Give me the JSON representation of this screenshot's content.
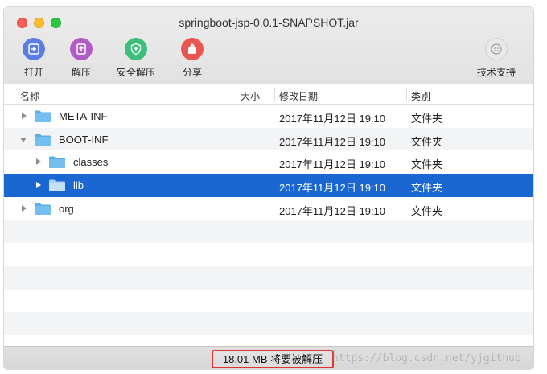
{
  "window": {
    "title": "springboot-jsp-0.0.1-SNAPSHOT.jar"
  },
  "toolbar": {
    "open_label": "打开",
    "extract_label": "解压",
    "secure_extract_label": "安全解压",
    "share_label": "分享",
    "support_label": "技术支持"
  },
  "columns": {
    "name": "名称",
    "size": "大小",
    "date": "修改日期",
    "kind": "类别"
  },
  "files": [
    {
      "name": "META-INF",
      "date": "2017年11月12日 19:10",
      "kind": "文件夹",
      "level": 0,
      "expanded": false,
      "selected": false
    },
    {
      "name": "BOOT-INF",
      "date": "2017年11月12日 19:10",
      "kind": "文件夹",
      "level": 0,
      "expanded": true,
      "selected": false
    },
    {
      "name": "classes",
      "date": "2017年11月12日 19:10",
      "kind": "文件夹",
      "level": 1,
      "expanded": false,
      "selected": false
    },
    {
      "name": "lib",
      "date": "2017年11月12日 19:10",
      "kind": "文件夹",
      "level": 1,
      "expanded": false,
      "selected": true
    },
    {
      "name": "org",
      "date": "2017年11月12日 19:10",
      "kind": "文件夹",
      "level": 0,
      "expanded": false,
      "selected": false
    }
  ],
  "status": {
    "text": "18.01 MB 将要被解压",
    "watermark": "https://blog.csdn.net/yjgithub"
  },
  "colors": {
    "selection": "#1a67d2",
    "folder": "#5aaee8",
    "highlight_border": "#e0342f"
  }
}
